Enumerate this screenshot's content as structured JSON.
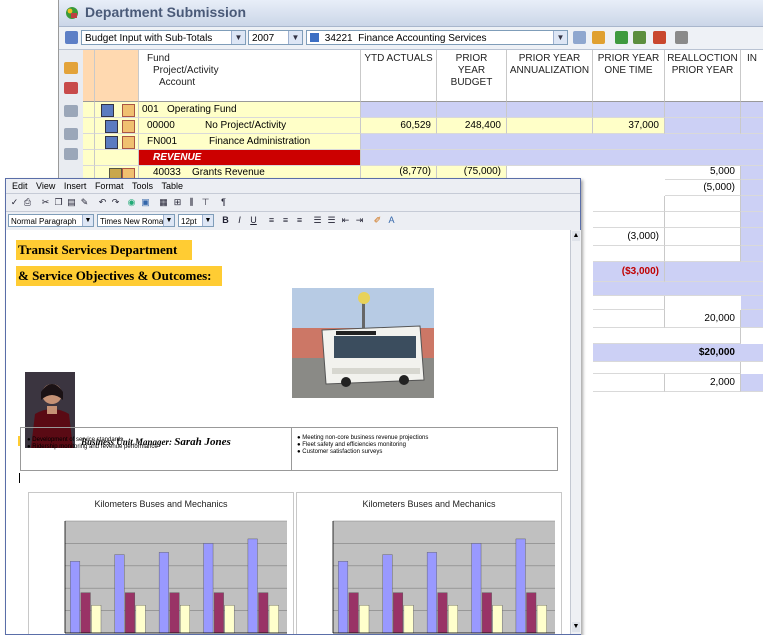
{
  "sheet": {
    "title": "Department Submission",
    "report_select": "Budget Input with Sub-Totals",
    "year_select": "2007",
    "dept_code": "34221",
    "dept_select": "Finance Accounting Services",
    "columns": [
      "Fund",
      "Project/Activity",
      "Account",
      "YTD ACTUALS",
      "PRIOR",
      "YEAR",
      "BUDGET",
      "PRIOR YEAR",
      "ANNUALIZATION",
      "PRIOR YEAR",
      "ONE TIME",
      "REALLOCTION",
      "PRIOR YEAR",
      "IN"
    ],
    "rows": {
      "fund_label": "001",
      "fund_name": "Operating Fund",
      "project_code": "00000",
      "project_name": "No Project/Activity",
      "project_ytd": "60,529",
      "project_budget": "248,400",
      "project_onetime": "37,000",
      "account_code": "FN001",
      "account_name": "Finance Administration",
      "revenue_label": "REVENUE",
      "grant_code": "40033",
      "grant_name": "Grants Revenue",
      "grant_ytd": "(8,770)",
      "grant_budget": "(75,000)",
      "grant_realloc": "5,000",
      "r2_realloc": "(5,000)",
      "r3_onetime": "(3,000)",
      "r4_onetime": "($3,000)",
      "r5_realloc": "20,000",
      "r6_realloc": "$20,000",
      "r7_realloc": "2,000"
    }
  },
  "word": {
    "menu": [
      "Edit",
      "View",
      "Insert",
      "Format",
      "Tools",
      "Table"
    ],
    "style_select": "Normal Paragraph",
    "font_select": "Times New Roman",
    "size_select": "12pt",
    "heading1": "Transit Services Department",
    "heading2": "&   Service Objectives & Outcomes:",
    "manager_label": "Business Unit Manager:",
    "manager_name": "Sarah Jones",
    "bullets_left": [
      "Development of service standards",
      "Ridership monitoring and revenue performance"
    ],
    "bullets_right": [
      "Meeting non-core business revenue projections",
      "Fleet safety and efficiencies monitoring",
      "Customer satisfaction surveys"
    ]
  },
  "chart_data": [
    {
      "type": "bar",
      "title": "Kilometers Buses and Mechanics",
      "categories": [
        "",
        "",
        "",
        "",
        ""
      ],
      "series": [
        {
          "values": [
            1600000,
            1750000,
            1800000,
            2000000,
            2100000
          ],
          "color": "#9999ff"
        },
        {
          "values": [
            900000,
            900000,
            900000,
            900000,
            900000
          ],
          "color": "#993366"
        },
        {
          "values": [
            620000,
            620000,
            620000,
            620000,
            620000
          ],
          "color": "#ffffcc"
        }
      ],
      "ylim": [
        0,
        2500000
      ],
      "grid": true
    },
    {
      "type": "bar",
      "title": "Kilometers Buses and Mechanics",
      "categories": [
        "",
        "",
        "",
        "",
        ""
      ],
      "series": [
        {
          "values": [
            1600000,
            1750000,
            1800000,
            2000000,
            2100000
          ],
          "color": "#9999ff"
        },
        {
          "values": [
            900000,
            900000,
            900000,
            900000,
            900000
          ],
          "color": "#993366"
        },
        {
          "values": [
            620000,
            620000,
            620000,
            620000,
            620000
          ],
          "color": "#ffffcc"
        }
      ],
      "ylim": [
        0,
        2500000
      ],
      "grid": true
    }
  ]
}
